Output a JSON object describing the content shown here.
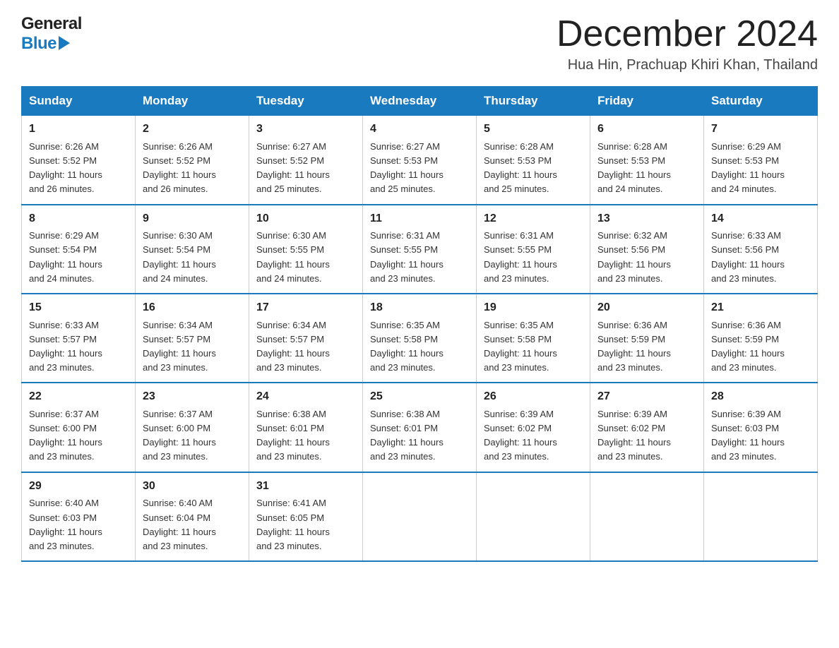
{
  "header": {
    "month_title": "December 2024",
    "location": "Hua Hin, Prachuap Khiri Khan, Thailand",
    "logo_line1": "General",
    "logo_line2": "Blue"
  },
  "days_of_week": [
    "Sunday",
    "Monday",
    "Tuesday",
    "Wednesday",
    "Thursday",
    "Friday",
    "Saturday"
  ],
  "weeks": [
    [
      {
        "day": "1",
        "sunrise": "6:26 AM",
        "sunset": "5:52 PM",
        "daylight": "11 hours and 26 minutes."
      },
      {
        "day": "2",
        "sunrise": "6:26 AM",
        "sunset": "5:52 PM",
        "daylight": "11 hours and 26 minutes."
      },
      {
        "day": "3",
        "sunrise": "6:27 AM",
        "sunset": "5:52 PM",
        "daylight": "11 hours and 25 minutes."
      },
      {
        "day": "4",
        "sunrise": "6:27 AM",
        "sunset": "5:53 PM",
        "daylight": "11 hours and 25 minutes."
      },
      {
        "day": "5",
        "sunrise": "6:28 AM",
        "sunset": "5:53 PM",
        "daylight": "11 hours and 25 minutes."
      },
      {
        "day": "6",
        "sunrise": "6:28 AM",
        "sunset": "5:53 PM",
        "daylight": "11 hours and 24 minutes."
      },
      {
        "day": "7",
        "sunrise": "6:29 AM",
        "sunset": "5:53 PM",
        "daylight": "11 hours and 24 minutes."
      }
    ],
    [
      {
        "day": "8",
        "sunrise": "6:29 AM",
        "sunset": "5:54 PM",
        "daylight": "11 hours and 24 minutes."
      },
      {
        "day": "9",
        "sunrise": "6:30 AM",
        "sunset": "5:54 PM",
        "daylight": "11 hours and 24 minutes."
      },
      {
        "day": "10",
        "sunrise": "6:30 AM",
        "sunset": "5:55 PM",
        "daylight": "11 hours and 24 minutes."
      },
      {
        "day": "11",
        "sunrise": "6:31 AM",
        "sunset": "5:55 PM",
        "daylight": "11 hours and 23 minutes."
      },
      {
        "day": "12",
        "sunrise": "6:31 AM",
        "sunset": "5:55 PM",
        "daylight": "11 hours and 23 minutes."
      },
      {
        "day": "13",
        "sunrise": "6:32 AM",
        "sunset": "5:56 PM",
        "daylight": "11 hours and 23 minutes."
      },
      {
        "day": "14",
        "sunrise": "6:33 AM",
        "sunset": "5:56 PM",
        "daylight": "11 hours and 23 minutes."
      }
    ],
    [
      {
        "day": "15",
        "sunrise": "6:33 AM",
        "sunset": "5:57 PM",
        "daylight": "11 hours and 23 minutes."
      },
      {
        "day": "16",
        "sunrise": "6:34 AM",
        "sunset": "5:57 PM",
        "daylight": "11 hours and 23 minutes."
      },
      {
        "day": "17",
        "sunrise": "6:34 AM",
        "sunset": "5:57 PM",
        "daylight": "11 hours and 23 minutes."
      },
      {
        "day": "18",
        "sunrise": "6:35 AM",
        "sunset": "5:58 PM",
        "daylight": "11 hours and 23 minutes."
      },
      {
        "day": "19",
        "sunrise": "6:35 AM",
        "sunset": "5:58 PM",
        "daylight": "11 hours and 23 minutes."
      },
      {
        "day": "20",
        "sunrise": "6:36 AM",
        "sunset": "5:59 PM",
        "daylight": "11 hours and 23 minutes."
      },
      {
        "day": "21",
        "sunrise": "6:36 AM",
        "sunset": "5:59 PM",
        "daylight": "11 hours and 23 minutes."
      }
    ],
    [
      {
        "day": "22",
        "sunrise": "6:37 AM",
        "sunset": "6:00 PM",
        "daylight": "11 hours and 23 minutes."
      },
      {
        "day": "23",
        "sunrise": "6:37 AM",
        "sunset": "6:00 PM",
        "daylight": "11 hours and 23 minutes."
      },
      {
        "day": "24",
        "sunrise": "6:38 AM",
        "sunset": "6:01 PM",
        "daylight": "11 hours and 23 minutes."
      },
      {
        "day": "25",
        "sunrise": "6:38 AM",
        "sunset": "6:01 PM",
        "daylight": "11 hours and 23 minutes."
      },
      {
        "day": "26",
        "sunrise": "6:39 AM",
        "sunset": "6:02 PM",
        "daylight": "11 hours and 23 minutes."
      },
      {
        "day": "27",
        "sunrise": "6:39 AM",
        "sunset": "6:02 PM",
        "daylight": "11 hours and 23 minutes."
      },
      {
        "day": "28",
        "sunrise": "6:39 AM",
        "sunset": "6:03 PM",
        "daylight": "11 hours and 23 minutes."
      }
    ],
    [
      {
        "day": "29",
        "sunrise": "6:40 AM",
        "sunset": "6:03 PM",
        "daylight": "11 hours and 23 minutes."
      },
      {
        "day": "30",
        "sunrise": "6:40 AM",
        "sunset": "6:04 PM",
        "daylight": "11 hours and 23 minutes."
      },
      {
        "day": "31",
        "sunrise": "6:41 AM",
        "sunset": "6:05 PM",
        "daylight": "11 hours and 23 minutes."
      },
      null,
      null,
      null,
      null
    ]
  ],
  "labels": {
    "sunrise": "Sunrise:",
    "sunset": "Sunset:",
    "daylight": "Daylight:"
  }
}
